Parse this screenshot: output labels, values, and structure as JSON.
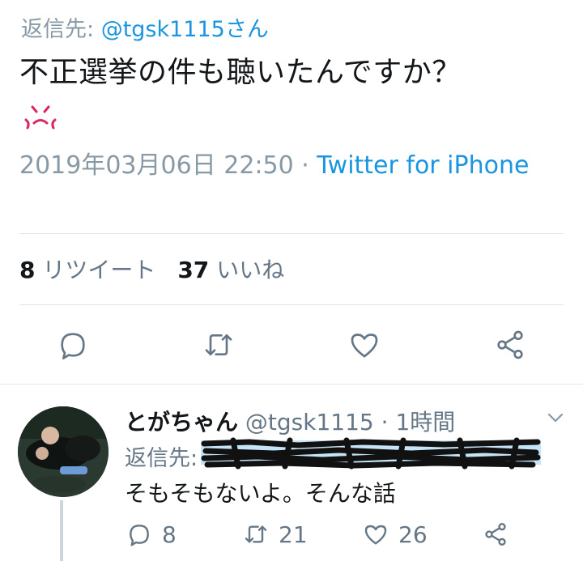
{
  "tweet": {
    "reply_prefix": "返信先: ",
    "reply_handle": "@tgsk1115",
    "reply_suffix": "さん",
    "text": "不正選挙の件も聴いたんですか？",
    "emoji": "anger-face-icon",
    "timestamp": "2019年03月06日 22:50",
    "separator": " · ",
    "via": "Twitter for iPhone",
    "retweets": "8",
    "retweets_label": "リツイート",
    "likes": "37",
    "likes_label": "いいね"
  },
  "reply": {
    "name": "とがちゃん",
    "handle": "@tgsk1115",
    "time": "· 1時間",
    "reply_prefix": "返信先:",
    "text": "そもそもないよ。そんな話",
    "replies": "8",
    "retweets": "21",
    "likes": "26"
  },
  "colors": {
    "link": "#1b95e0",
    "muted": "#657786",
    "divider": "#e1e8ed",
    "anger": "#e0245e"
  }
}
